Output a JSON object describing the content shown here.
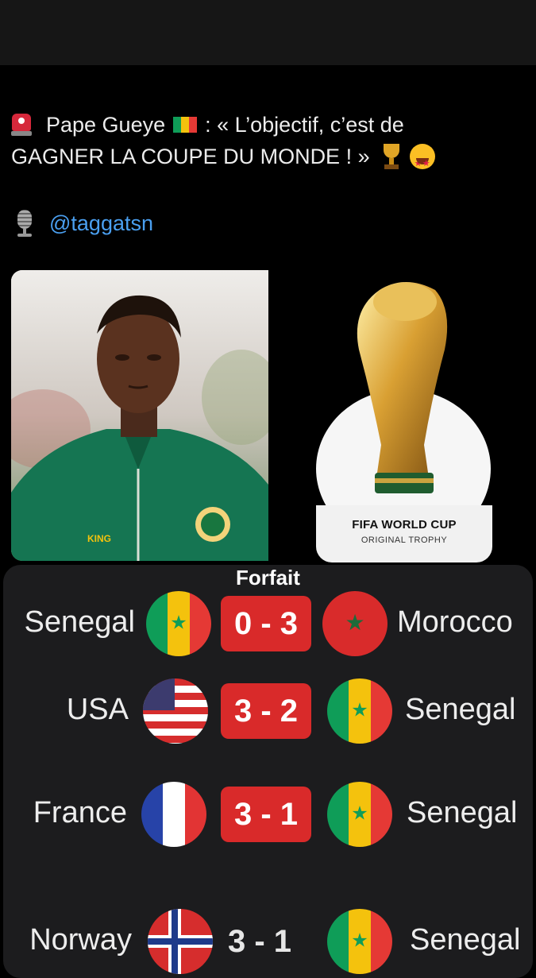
{
  "tweet": {
    "line1_author": "Pape Gueye",
    "line1_rest": ": « L’objectif, c’est de",
    "line2": "GAGNER LA COUPE DU MONDE ! »",
    "mention": "@taggatsn"
  },
  "icons": {
    "alarm": "police-light-icon",
    "flag": "senegal-flag-icon",
    "trophy": "trophy-icon",
    "face": "star-struck-face-icon",
    "mic": "studio-microphone-icon"
  },
  "images": {
    "trophy_caption_title": "FIFA WORLD CUP",
    "trophy_caption_sub": "ORIGINAL TROPHY",
    "jersey_text": "KING"
  },
  "scores": {
    "header": "Forfait",
    "matches": [
      {
        "home": "Senegal",
        "score": "0 - 3",
        "away": "Morocco"
      },
      {
        "home": "USA",
        "score": "3 - 2",
        "away": "Senegal"
      },
      {
        "home": "France",
        "score": "3 - 1",
        "away": "Senegal"
      },
      {
        "home": "Norway",
        "score": "3 - 1",
        "away": "Senegal"
      }
    ]
  },
  "colors": {
    "mention": "#4a9ff0",
    "score_badge": "#d92a2a",
    "card_bg": "#1c1c1e"
  }
}
